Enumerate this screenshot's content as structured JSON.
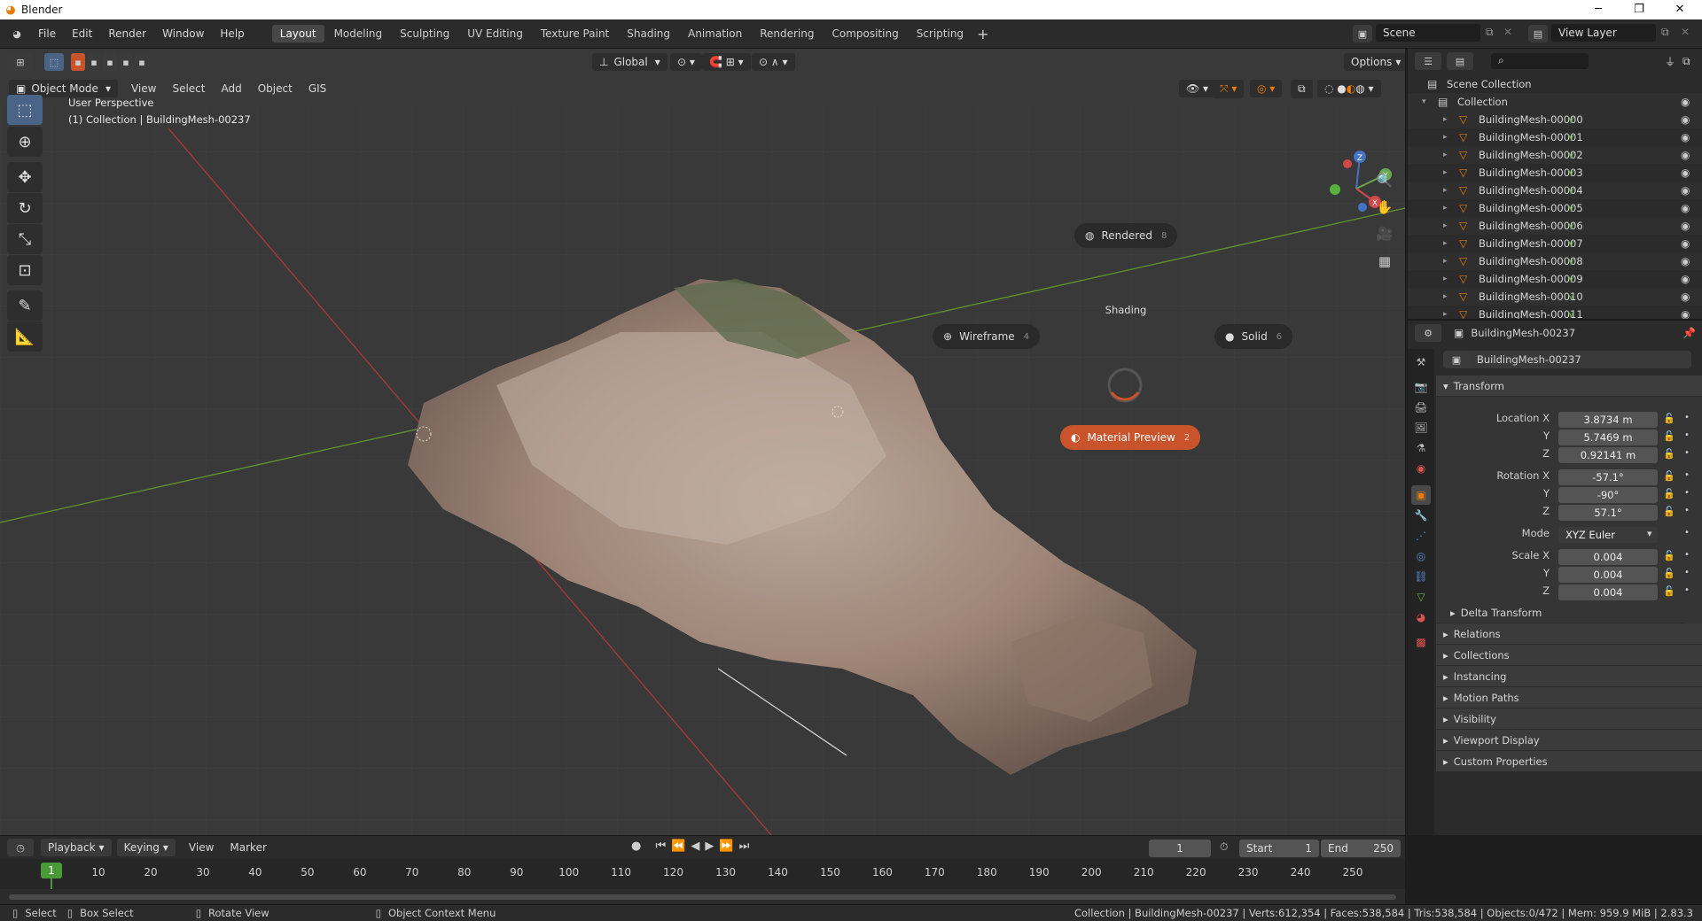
{
  "window": {
    "title": "Blender"
  },
  "menus": [
    "File",
    "Edit",
    "Render",
    "Window",
    "Help"
  ],
  "workspaces": [
    "Layout",
    "Modeling",
    "Sculpting",
    "UV Editing",
    "Texture Paint",
    "Shading",
    "Animation",
    "Rendering",
    "Compositing",
    "Scripting"
  ],
  "scene": {
    "label": "Scene",
    "view_layer": "View Layer"
  },
  "viewport": {
    "mode": "Object Mode",
    "header_menus": [
      "View",
      "Select",
      "Add",
      "Object",
      "GIS"
    ],
    "orientation": "Global",
    "options": "Options",
    "overlay_line1": "User Perspective",
    "overlay_line2": "(1) Collection | BuildingMesh-00237"
  },
  "shading_pie": {
    "title": "Shading",
    "rendered": {
      "label": "Rendered",
      "key": "8"
    },
    "wireframe": {
      "label": "Wireframe",
      "key": "4"
    },
    "solid": {
      "label": "Solid",
      "key": "6"
    },
    "material": {
      "label": "Material Preview",
      "key": "2"
    }
  },
  "outliner": {
    "scene_collection": "Scene Collection",
    "collection": "Collection",
    "items": [
      "BuildingMesh-00000",
      "BuildingMesh-00001",
      "BuildingMesh-00002",
      "BuildingMesh-00003",
      "BuildingMesh-00004",
      "BuildingMesh-00005",
      "BuildingMesh-00006",
      "BuildingMesh-00007",
      "BuildingMesh-00008",
      "BuildingMesh-00009",
      "BuildingMesh-00010",
      "BuildingMesh-00011"
    ]
  },
  "properties": {
    "object_name": "BuildingMesh-00237",
    "transform_header": "Transform",
    "location_x_label": "Location X",
    "location_x": "3.8734 m",
    "location_y_label": "Y",
    "location_y": "5.7469 m",
    "location_z_label": "Z",
    "location_z": "0.92141 m",
    "rotation_x_label": "Rotation X",
    "rotation_x": "-57.1°",
    "rotation_y_label": "Y",
    "rotation_y": "-90°",
    "rotation_z_label": "Z",
    "rotation_z": "57.1°",
    "mode_label": "Mode",
    "mode": "XYZ Euler",
    "scale_x_label": "Scale X",
    "scale_x": "0.004",
    "scale_y_label": "Y",
    "scale_y": "0.004",
    "scale_z_label": "Z",
    "scale_z": "0.004",
    "delta_transform": "Delta Transform",
    "sections": [
      "Relations",
      "Collections",
      "Instancing",
      "Motion Paths",
      "Visibility",
      "Viewport Display",
      "Custom Properties"
    ]
  },
  "timeline": {
    "playback": "Playback",
    "keying": "Keying",
    "view": "View",
    "marker": "Marker",
    "current_frame": "1",
    "start_label": "Start",
    "start": "1",
    "end_label": "End",
    "end": "250",
    "playhead": "1",
    "ticks": [
      "10",
      "20",
      "30",
      "40",
      "50",
      "60",
      "70",
      "80",
      "90",
      "100",
      "110",
      "120",
      "130",
      "140",
      "150",
      "160",
      "170",
      "180",
      "190",
      "200",
      "210",
      "220",
      "230",
      "240",
      "250"
    ]
  },
  "status": {
    "select": "Select",
    "box_select": "Box Select",
    "rotate_view": "Rotate View",
    "context_menu": "Object Context Menu",
    "stats": "Collection | BuildingMesh-00237 | Verts:612,354 | Faces:538,584 | Tris:538,584 | Objects:0/472 | Mem: 959.9 MiB | 2.83.3"
  },
  "colors": {
    "accent": "#e87d0d",
    "active_tool": "#4a6488",
    "material_preview": "#c9532a",
    "playhead": "#4b9a3a"
  }
}
